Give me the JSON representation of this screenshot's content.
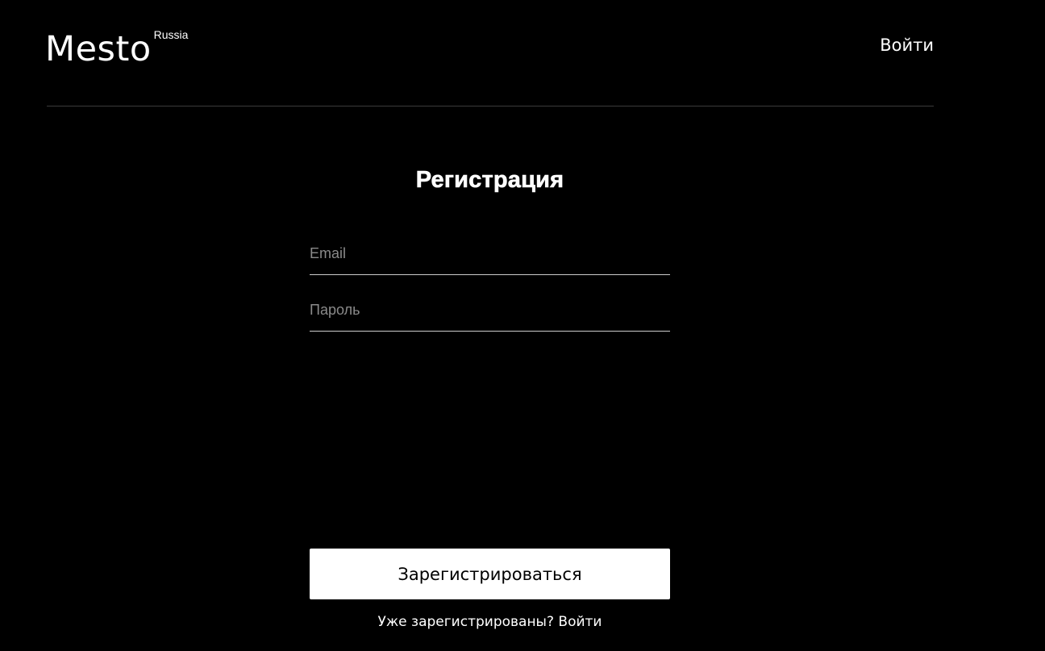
{
  "header": {
    "logo_text": "Mesto",
    "logo_superscript": "Russia",
    "login_link": "Войти"
  },
  "auth": {
    "title": "Регистрация",
    "email_placeholder": "Email",
    "email_value": "",
    "password_placeholder": "Пароль",
    "password_value": "",
    "submit_label": "Зарегистрироваться",
    "hint_text": "Уже зарегистрированы?",
    "hint_link": "Войти"
  },
  "colors": {
    "background": "#000000",
    "text": "#ffffff",
    "button_background": "#ffffff",
    "button_text": "#000000",
    "divider": "#545454",
    "placeholder": "#8a8a8a"
  }
}
